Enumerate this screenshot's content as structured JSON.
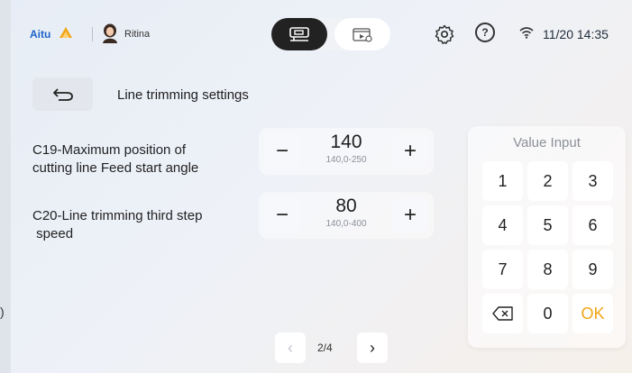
{
  "topbar": {
    "brand": "Aitu",
    "username": "Ritina",
    "clock": "11/20 14:35",
    "help_glyph": "?",
    "icons": {
      "brand_mark": "flame-logo-icon",
      "avatar": "user-avatar-icon",
      "sew_mode": "sewing-machine-icon",
      "video_mode": "video-icon",
      "settings": "gear-icon",
      "help": "help-icon",
      "wifi": "wifi-icon"
    }
  },
  "header": {
    "title": "Line trimming settings",
    "back_icon": "back-arrow-icon"
  },
  "params": [
    {
      "label_line1": "C19-Maximum position of",
      "label_line2": "cutting line Feed start angle",
      "value": "140",
      "range": "140,0-250",
      "minus": "−",
      "plus": "+"
    },
    {
      "label_line1": "C20-Line trimming third step",
      "label_line2": " speed",
      "value": "80",
      "range": "140,0-400",
      "minus": "−",
      "plus": "+"
    }
  ],
  "pagination": {
    "prev": "‹",
    "label": "2/4",
    "next": "›"
  },
  "keypad": {
    "title": "Value Input",
    "keys": [
      "1",
      "2",
      "3",
      "4",
      "5",
      "6",
      "7",
      "8",
      "9",
      "⌫",
      "0",
      "OK"
    ]
  },
  "edge_glyph": ")",
  "colors": {
    "brand_blue": "#1e63c7",
    "brand_orange": "#f2a516",
    "ok": "#f2a516"
  }
}
